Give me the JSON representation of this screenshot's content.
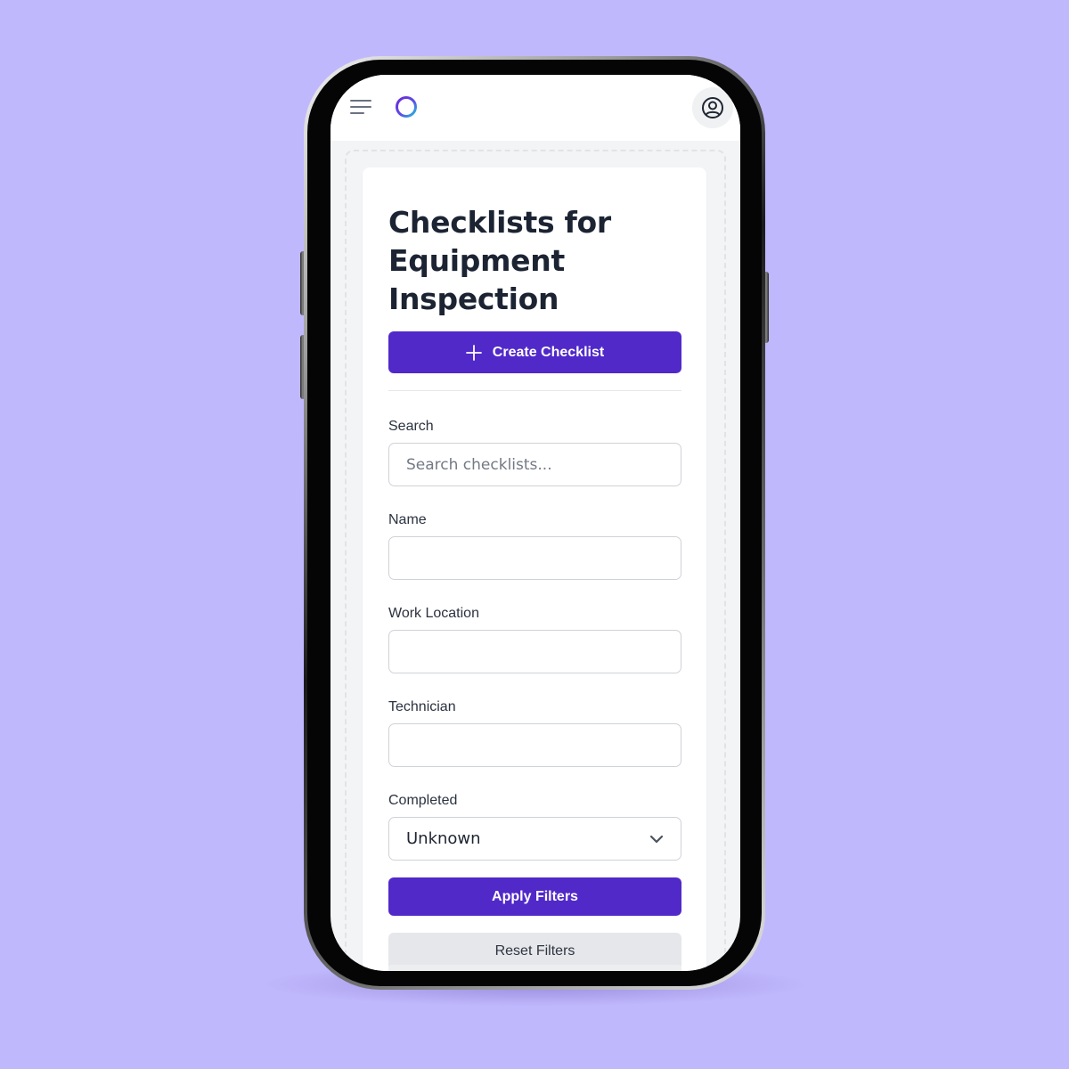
{
  "app": {
    "accent_color": "#5129c9",
    "logo_icon": "ring-logo-icon",
    "menu_icon": "hamburger-menu-icon",
    "profile_icon": "user-circle-icon"
  },
  "page": {
    "title": "Checklists for Equipment Inspection",
    "create_button_label": "Create Checklist",
    "create_button_icon": "plus-icon"
  },
  "filters": {
    "search": {
      "label": "Search",
      "placeholder": "Search checklists..."
    },
    "name": {
      "label": "Name",
      "value": ""
    },
    "work_location": {
      "label": "Work Location",
      "value": ""
    },
    "technician": {
      "label": "Technician",
      "value": ""
    },
    "completed": {
      "label": "Completed",
      "selected": "Unknown",
      "icon": "chevron-down-icon"
    },
    "apply_label": "Apply Filters",
    "reset_label": "Reset Filters"
  }
}
